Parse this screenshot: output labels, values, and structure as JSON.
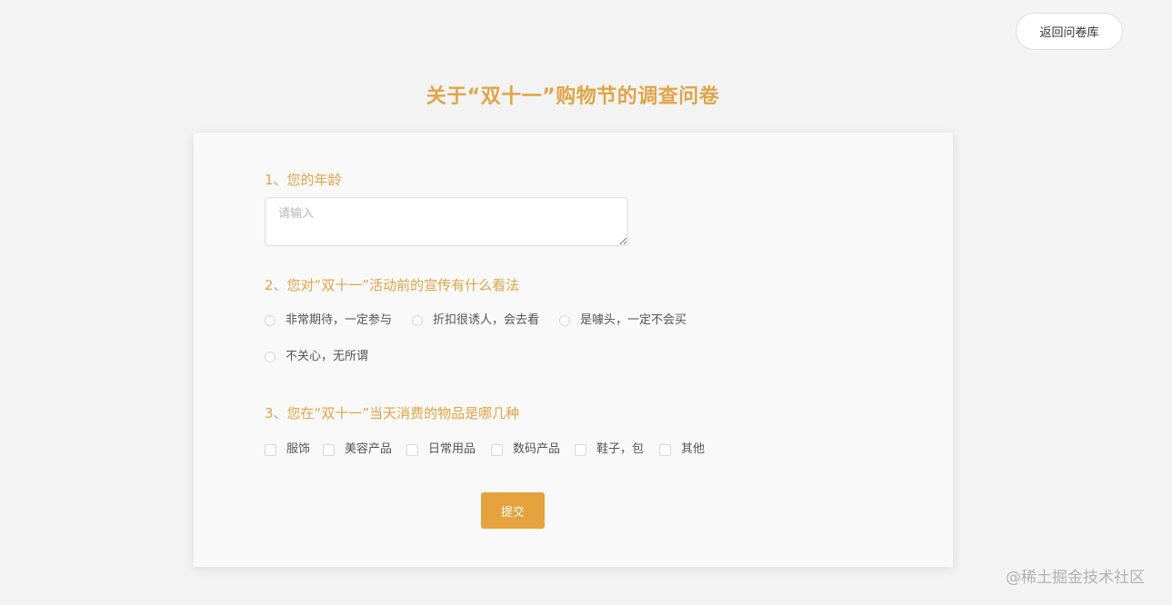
{
  "header": {
    "back_button_label": "返回问卷库"
  },
  "survey": {
    "title": "关于“双十一”购物节的调查问卷",
    "questions": [
      {
        "title": "1、您的年龄",
        "input_value": "",
        "input_placeholder": "请输入"
      },
      {
        "title": "2、您对“双十一”活动前的宣传有什么看法",
        "options": [
          "非常期待，一定参与",
          "折扣很诱人，会去看",
          "是噱头，一定不会买",
          "不关心，无所谓"
        ]
      },
      {
        "title": "3、您在“双十一”当天消费的物品是哪几种",
        "options": [
          "服饰",
          "美容产品",
          "日常用品",
          "数码产品",
          "鞋子，包",
          "其他"
        ]
      }
    ],
    "submit_label": "提交"
  },
  "watermark": "@稀土掘金技术社区",
  "colors": {
    "accent": "#e2a447",
    "submit": "#e6a23c",
    "background": "#f3f3f3",
    "card": "#f9f9f9"
  }
}
